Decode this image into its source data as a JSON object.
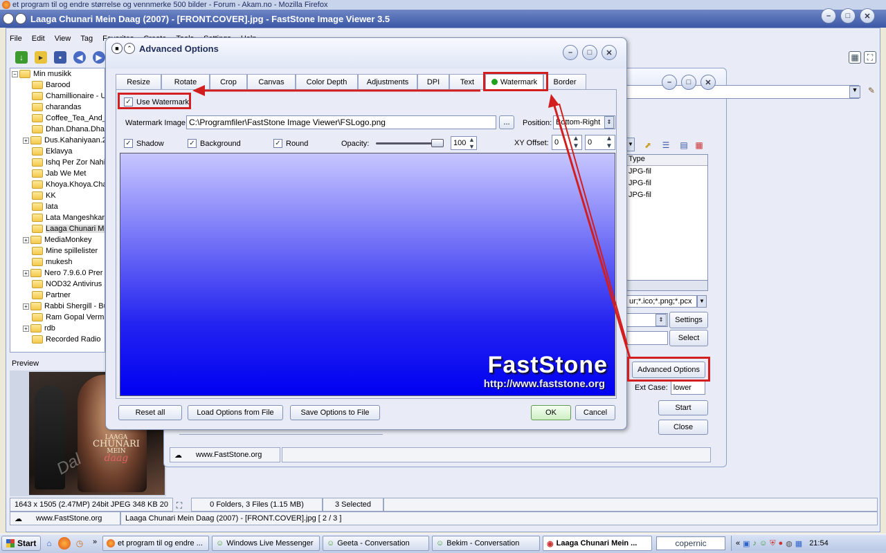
{
  "firefox_strip": "et program til og endre størrelse og vennmerke 500 bilder - Forum - Akam.no - Mozilla Firefox",
  "main": {
    "title": "Laaga Chunari Mein Daag (2007) -  [FRONT.COVER].jpg  -  FastStone Image Viewer 3.5",
    "menu": [
      "File",
      "Edit",
      "View",
      "Tag",
      "Favorites",
      "Create",
      "Tools",
      "Settings",
      "Help"
    ],
    "tree": [
      {
        "label": "Min musikk",
        "expand": false,
        "root": true
      },
      {
        "label": "Barood",
        "expand": false
      },
      {
        "label": "Chamillionaire - Ul",
        "expand": false
      },
      {
        "label": "charandas",
        "expand": false
      },
      {
        "label": "Coffee_Tea_And_",
        "expand": false
      },
      {
        "label": "Dhan.Dhana.Dha",
        "expand": false
      },
      {
        "label": "Dus.Kahaniyaan.2",
        "expand": true
      },
      {
        "label": "Eklavya",
        "expand": false
      },
      {
        "label": "Ishq Per Zor Nahi",
        "expand": false
      },
      {
        "label": "Jab We Met",
        "expand": false
      },
      {
        "label": "Khoya.Khoya.Cha",
        "expand": false
      },
      {
        "label": "KK",
        "expand": false
      },
      {
        "label": "lata",
        "expand": false
      },
      {
        "label": "Lata Mangeshkar",
        "expand": false
      },
      {
        "label": "Laaga Chunari Me",
        "expand": false,
        "selected": true
      },
      {
        "label": "MediaMonkey",
        "expand": true
      },
      {
        "label": "Mine spillelister",
        "expand": false
      },
      {
        "label": "mukesh",
        "expand": false
      },
      {
        "label": "Nero 7.9.6.0 Prer",
        "expand": true
      },
      {
        "label": "NOD32 Antivirus S",
        "expand": false
      },
      {
        "label": "Partner",
        "expand": false
      },
      {
        "label": "Rabbi Shergill - Bu",
        "expand": true
      },
      {
        "label": "Ram Gopal Verma",
        "expand": false
      },
      {
        "label": "rdb",
        "expand": true
      },
      {
        "label": "Recorded Radio",
        "expand": false
      }
    ],
    "preview_label": "Preview",
    "preview_watermark": "Dal",
    "cover_line1": "LAAGA",
    "cover_line2": "CHUNARI",
    "cover_line3": "MEIN",
    "cover_line4": "daag",
    "status": {
      "image_info": "1643 x 1505 (2.47MP)   24bit JPEG   348 KB   20",
      "folders": "0 Folders, 3 Files (1.15 MB)",
      "selected": "3 Selected",
      "site": "www.FastStone.org",
      "file": "Laaga Chunari Mein Daag (2007) -  [FRONT.COVER].jpg  [ 2 / 3 ]"
    }
  },
  "batch": {
    "type_header": "Type",
    "types": [
      "JPG-fil",
      "JPG-fil",
      "JPG-fil"
    ],
    "filter": "ur;*.ico;*.png;*.pcx",
    "settings_btn": "Settings",
    "select_btn": "Select",
    "advanced_btn": "Advanced Options",
    "ext_case_label": "Ext Case:",
    "ext_case_value": "lower",
    "start_btn": "Start",
    "close_btn": "Close",
    "site": "www.FastStone.org"
  },
  "adv": {
    "title": "Advanced Options",
    "tabs": [
      "Resize",
      "Rotate",
      "Crop",
      "Canvas",
      "Color Depth",
      "Adjustments",
      "DPI",
      "Text",
      "Watermark",
      "Border"
    ],
    "active_tab": "Watermark",
    "use_watermark": "Use Watermark",
    "watermark_image_label": "Watermark Image:",
    "watermark_image_path": "C:\\Programfiler\\FastStone Image Viewer\\FSLogo.png",
    "browse": "...",
    "position_label": "Position:",
    "position_value": "Bottom-Right",
    "shadow": "Shadow",
    "background": "Background",
    "round": "Round",
    "opacity_label": "Opacity:",
    "opacity_value": "100",
    "xy_label": "XY Offset:",
    "x_value": "0",
    "y_value": "0",
    "logo_text": "FastStone",
    "logo_url": "http://www.faststone.org",
    "reset_btn": "Reset all",
    "load_btn": "Load Options from File",
    "save_btn": "Save Options to File",
    "ok_btn": "OK",
    "cancel_btn": "Cancel"
  },
  "taskbar": {
    "start": "Start",
    "tasks": [
      "et program til og endre ...",
      "Windows Live Messenger",
      "Geeta - Conversation",
      "Bekim - Conversation",
      "Laaga Chunari Mein ..."
    ],
    "search": "copernic",
    "clock": "21:54"
  },
  "colors": {
    "accent_red": "#d21e1e",
    "title_blue": "#3b57a6",
    "watermark_green": "#1fa31f"
  }
}
